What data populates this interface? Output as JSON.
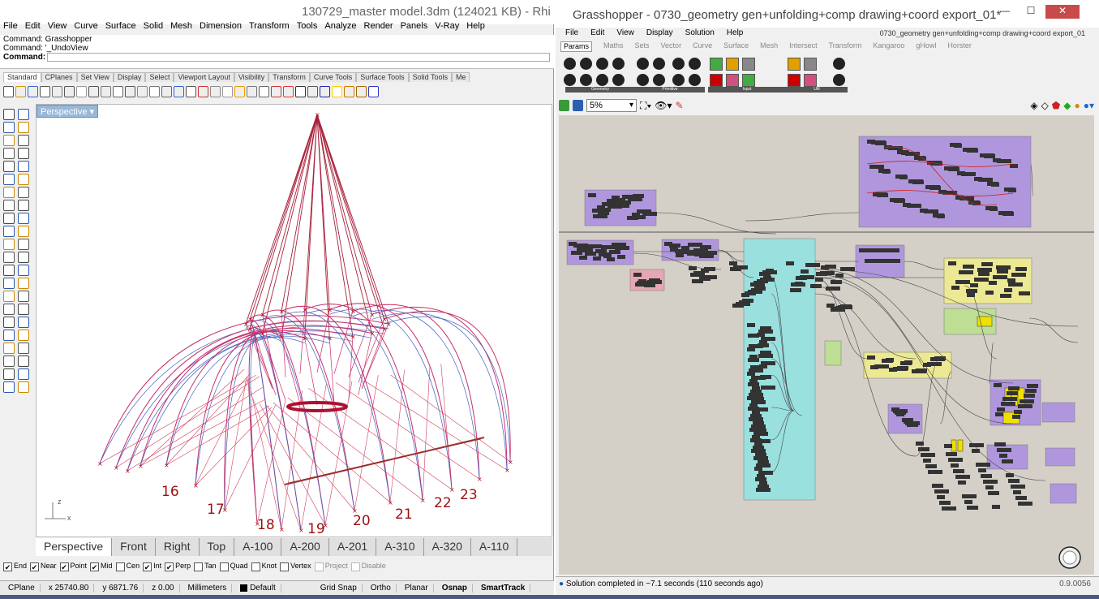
{
  "rhino": {
    "title": "130729_master model.3dm (124021 KB) - Rhi",
    "menu": [
      "File",
      "Edit",
      "View",
      "Curve",
      "Surface",
      "Solid",
      "Mesh",
      "Dimension",
      "Transform",
      "Tools",
      "Analyze",
      "Render",
      "Panels",
      "V-Ray",
      "Help"
    ],
    "command_history": [
      "Command: Grasshopper",
      "Command: '_UndoView"
    ],
    "command_prompt": "Command:",
    "toolbar_tabs": [
      "Standard",
      "CPlanes",
      "Set View",
      "Display",
      "Select",
      "Viewport Layout",
      "Visibility",
      "Transform",
      "Curve Tools",
      "Surface Tools",
      "Solid Tools",
      "Me"
    ],
    "viewport_label": "Perspective",
    "point_labels": [
      "16",
      "17",
      "18",
      "19",
      "20",
      "21",
      "22",
      "23"
    ],
    "axis_labels": {
      "z": "z",
      "x": "x"
    },
    "viewport_tabs": [
      "Perspective",
      "Front",
      "Right",
      "Top",
      "A-100",
      "A-200",
      "A-201",
      "A-310",
      "A-320",
      "A-110"
    ],
    "osnaps": [
      {
        "label": "End",
        "checked": true
      },
      {
        "label": "Near",
        "checked": true
      },
      {
        "label": "Point",
        "checked": true
      },
      {
        "label": "Mid",
        "checked": true
      },
      {
        "label": "Cen",
        "checked": false
      },
      {
        "label": "Int",
        "checked": true
      },
      {
        "label": "Perp",
        "checked": true
      },
      {
        "label": "Tan",
        "checked": false
      },
      {
        "label": "Quad",
        "checked": false
      },
      {
        "label": "Knot",
        "checked": false
      },
      {
        "label": "Vertex",
        "checked": false
      },
      {
        "label": "Project",
        "checked": false
      },
      {
        "label": "Disable",
        "checked": false
      }
    ],
    "status": {
      "cplane": "CPlane",
      "x": "x 25740.80",
      "y": "y 6871.76",
      "z": "z 0.00",
      "units": "Millimeters",
      "layer": "Default",
      "grid_snap": "Grid Snap",
      "ortho": "Ortho",
      "planar": "Planar",
      "osnap": "Osnap",
      "smarttrack": "SmartTrack"
    },
    "colors": {
      "geometry": "#c8306a",
      "edges": "#4060c0",
      "points": "#b01010"
    }
  },
  "grasshopper": {
    "title": "Grasshopper - 0730_geometry gen+unfolding+comp drawing+coord export_01*",
    "doc_name": "0730_geometry gen+unfolding+comp drawing+coord export_01",
    "menu": [
      "File",
      "Edit",
      "View",
      "Display",
      "Solution",
      "Help"
    ],
    "tabs": [
      "Params",
      "Maths",
      "Sets",
      "Vector",
      "Curve",
      "Surface",
      "Mesh",
      "Intersect",
      "Transform",
      "Kangaroo",
      "gHowl",
      "Horster"
    ],
    "groups": [
      "Geometry",
      "Primitive",
      "Input",
      "Util"
    ],
    "zoom": "5%",
    "status_message": "Solution completed in ~7.1 seconds (110 seconds ago)",
    "version": "0.9.0056",
    "colors": {
      "canvas": "#d4d0c8",
      "purple": "#a98de0",
      "cyan": "#8fe3e3",
      "yellow": "#f0ec8a",
      "pink": "#e8a0b0",
      "green": "#b8e08a"
    }
  }
}
